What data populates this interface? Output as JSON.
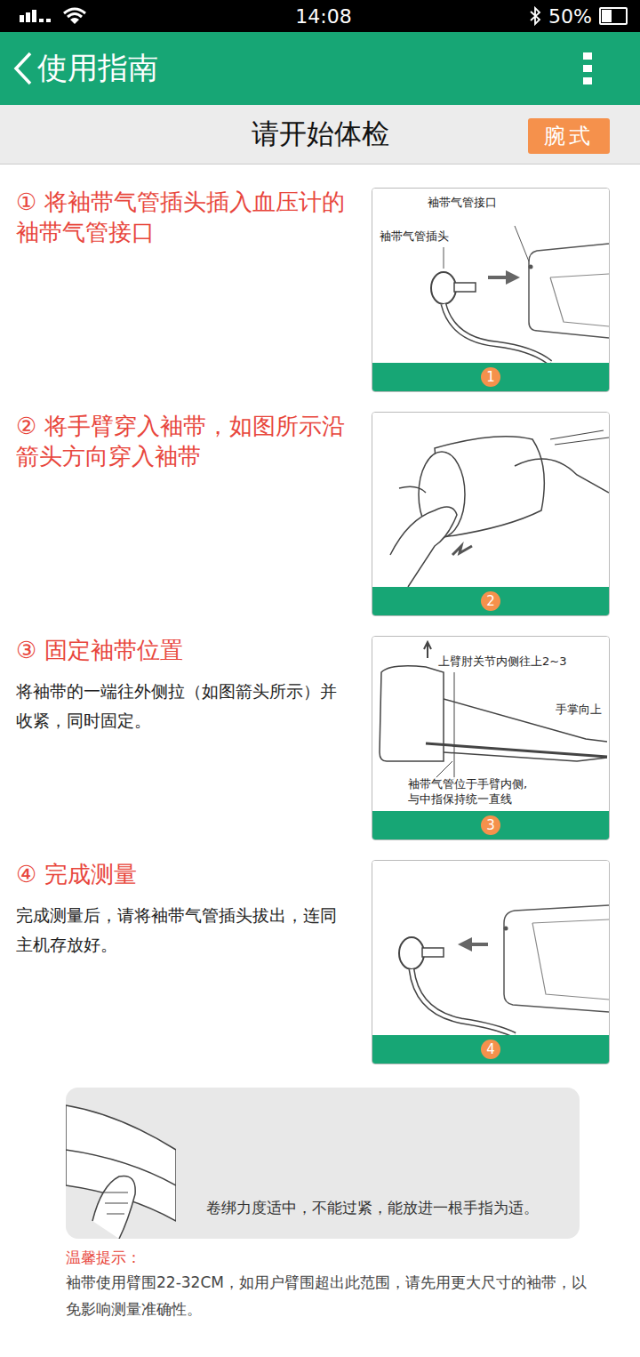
{
  "status_bar": {
    "time": "14:08",
    "battery": "50%",
    "battery_level": 0.5
  },
  "header": {
    "title": "使用指南"
  },
  "subheader": {
    "title": "请开始体检",
    "mode_button": "腕式"
  },
  "steps": [
    {
      "title": "① 将袖带气管插头插入血压计的袖带气管接口",
      "description": "",
      "figure_number": "1",
      "kind": "plug-in",
      "labels": [
        "袖带气管接口",
        "袖带气管插头"
      ]
    },
    {
      "title": "② 将手臂穿入袖带，如图所示沿箭头方向穿入袖带",
      "description": "",
      "figure_number": "2",
      "kind": "wear",
      "labels": []
    },
    {
      "title": "③ 固定袖带位置",
      "description": "将袖带的一端往外侧拉（如图箭头所示）并收紧，同时固定。",
      "figure_number": "3",
      "kind": "position",
      "labels": [
        "上臂肘关节内侧往上2~3",
        "手掌向上",
        "袖带气管位于手臂内侧,",
        "与中指保持统一直线"
      ]
    },
    {
      "title": "④ 完成测量",
      "description": "完成测量后，请将袖带气管插头拔出，连同主机存放好。",
      "figure_number": "4",
      "kind": "unplug",
      "labels": []
    }
  ],
  "tip": {
    "text": "卷绑力度适中，不能过紧，能放进一根手指为适。"
  },
  "notice": {
    "title": "温馨提示：",
    "text": "袖带使用臂围22-32CM，如用户臂围超出此范围，请先用更大尺寸的袖带，以免影响测量准确性。"
  }
}
